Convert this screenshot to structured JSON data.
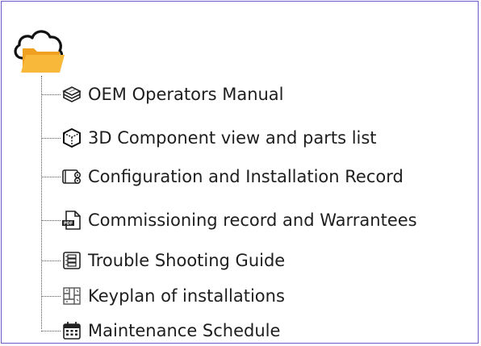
{
  "tree": {
    "root_icon": "cloud-folder-icon",
    "items": [
      {
        "label": "OEM Operators Manual",
        "icon": "manual-books-icon"
      },
      {
        "label": "3D Component view and parts list",
        "icon": "3d-cube-icon"
      },
      {
        "label": "Configuration and Installation Record",
        "icon": "config-record-icon"
      },
      {
        "label": "Commissioning record and Warrantees",
        "icon": "pdf-file-icon"
      },
      {
        "label": "Trouble Shooting Guide",
        "icon": "troubleshooting-icon"
      },
      {
        "label": "Keyplan of installations",
        "icon": "keyplan-icon"
      },
      {
        "label": "Maintenance Schedule",
        "icon": "calendar-icon"
      }
    ]
  },
  "colors": {
    "frame_border": "#6a5acd",
    "folder": "#f5a623",
    "text": "#1e1e1e"
  }
}
